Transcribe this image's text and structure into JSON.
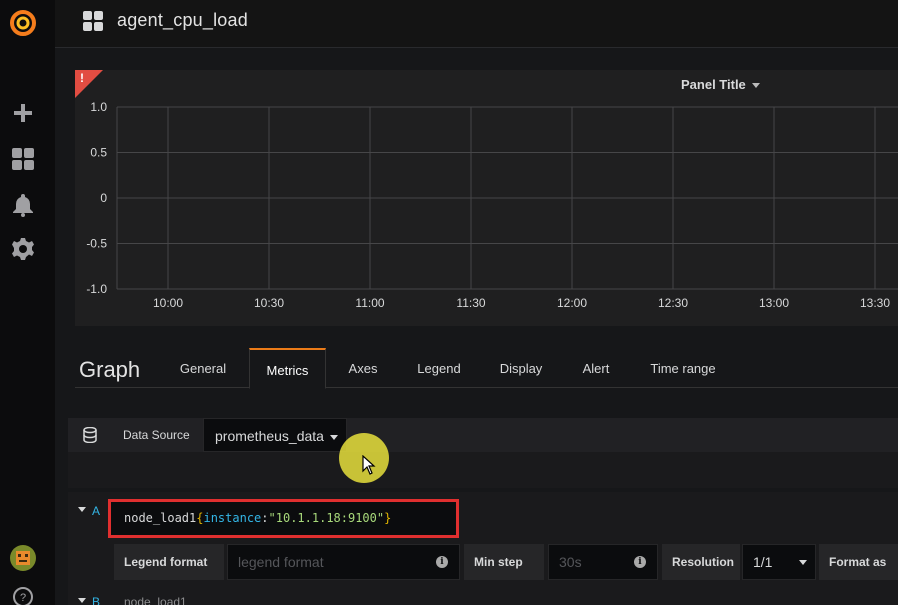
{
  "navbar": {
    "dashboard_title": "agent_cpu_load"
  },
  "panel": {
    "title": "Panel Title",
    "alert_mark": "!"
  },
  "chart_data": {
    "type": "line",
    "series": [],
    "y_ticks": [
      "1.0",
      "0.5",
      "0",
      "-0.5",
      "-1.0"
    ],
    "x_ticks": [
      "10:00",
      "10:30",
      "11:00",
      "11:30",
      "12:00",
      "12:30",
      "13:00",
      "13:30"
    ],
    "ylim": [
      -1.0,
      1.0
    ],
    "grid": true
  },
  "editor": {
    "title": "Graph",
    "tabs": [
      {
        "label": "General"
      },
      {
        "label": "Metrics"
      },
      {
        "label": "Axes"
      },
      {
        "label": "Legend"
      },
      {
        "label": "Display"
      },
      {
        "label": "Alert"
      },
      {
        "label": "Time range"
      }
    ],
    "active_tab": "Metrics"
  },
  "datasource": {
    "label": "Data Source",
    "value": "prometheus_data"
  },
  "query_a": {
    "letter": "A",
    "metric": "node_load1",
    "brace_open": "{",
    "label_name": "instance",
    "eq": ":",
    "label_value": "\"10.1.1.18:9100\"",
    "brace_close": "}",
    "legend_format_label": "Legend format",
    "legend_format_placeholder": "legend format",
    "min_step_label": "Min step",
    "min_step_placeholder": "30s",
    "resolution_label": "Resolution",
    "resolution_value": "1/1",
    "format_as_label": "Format as",
    "info_glyph": "i"
  },
  "query_b": {
    "letter": "B",
    "partial_text": "node_load1"
  },
  "colors": {
    "accent": "#eb7b18",
    "alert": "#e24d42",
    "highlight_box": "#e02f2f",
    "cursor_halo": "#e8e03c"
  }
}
